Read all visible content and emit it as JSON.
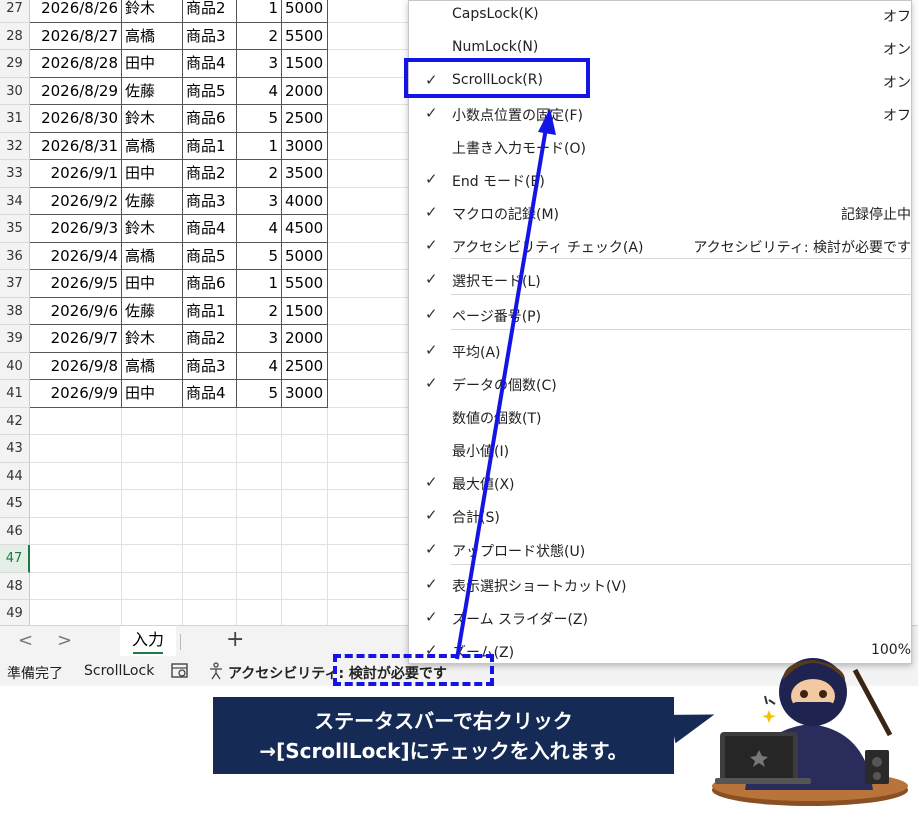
{
  "sheet": {
    "rows": [
      {
        "n": "27",
        "date": "2026/8/26",
        "name": "鈴木",
        "item": "商品2",
        "qty": "1",
        "amount": "5000"
      },
      {
        "n": "28",
        "date": "2026/8/27",
        "name": "高橋",
        "item": "商品3",
        "qty": "2",
        "amount": "5500"
      },
      {
        "n": "29",
        "date": "2026/8/28",
        "name": "田中",
        "item": "商品4",
        "qty": "3",
        "amount": "1500"
      },
      {
        "n": "30",
        "date": "2026/8/29",
        "name": "佐藤",
        "item": "商品5",
        "qty": "4",
        "amount": "2000"
      },
      {
        "n": "31",
        "date": "2026/8/30",
        "name": "鈴木",
        "item": "商品6",
        "qty": "5",
        "amount": "2500"
      },
      {
        "n": "32",
        "date": "2026/8/31",
        "name": "高橋",
        "item": "商品1",
        "qty": "1",
        "amount": "3000"
      },
      {
        "n": "33",
        "date": "2026/9/1",
        "name": "田中",
        "item": "商品2",
        "qty": "2",
        "amount": "3500"
      },
      {
        "n": "34",
        "date": "2026/9/2",
        "name": "佐藤",
        "item": "商品3",
        "qty": "3",
        "amount": "4000"
      },
      {
        "n": "35",
        "date": "2026/9/3",
        "name": "鈴木",
        "item": "商品4",
        "qty": "4",
        "amount": "4500"
      },
      {
        "n": "36",
        "date": "2026/9/4",
        "name": "高橋",
        "item": "商品5",
        "qty": "5",
        "amount": "5000"
      },
      {
        "n": "37",
        "date": "2026/9/5",
        "name": "田中",
        "item": "商品6",
        "qty": "1",
        "amount": "5500"
      },
      {
        "n": "38",
        "date": "2026/9/6",
        "name": "佐藤",
        "item": "商品1",
        "qty": "2",
        "amount": "1500"
      },
      {
        "n": "39",
        "date": "2026/9/7",
        "name": "鈴木",
        "item": "商品2",
        "qty": "3",
        "amount": "2000"
      },
      {
        "n": "40",
        "date": "2026/9/8",
        "name": "高橋",
        "item": "商品3",
        "qty": "4",
        "amount": "2500"
      },
      {
        "n": "41",
        "date": "2026/9/9",
        "name": "田中",
        "item": "商品4",
        "qty": "5",
        "amount": "3000"
      },
      {
        "n": "42"
      },
      {
        "n": "43"
      },
      {
        "n": "44"
      },
      {
        "n": "45"
      },
      {
        "n": "46"
      },
      {
        "n": "47",
        "selected": true
      },
      {
        "n": "48"
      },
      {
        "n": "49"
      }
    ]
  },
  "tabs": {
    "prev": "<",
    "next": ">",
    "active": "入力",
    "add": "+"
  },
  "status": {
    "ready": "準備完了",
    "scrolllock": "ScrollLock",
    "accessibility": "アクセシビリティ: 検討が必要です"
  },
  "menu": {
    "items": [
      {
        "label": "CapsLock(K)",
        "value": "オフ",
        "checked": false
      },
      {
        "label": "NumLock(N)",
        "value": "オン",
        "checked": false
      },
      {
        "label": "ScrollLock(R)",
        "value": "オン",
        "checked": true
      },
      {
        "label": "小数点位置の固定(F)",
        "value": "オフ",
        "checked": true
      },
      {
        "label": "上書き入力モード(O)",
        "value": "",
        "checked": false
      },
      {
        "label": "End モード(E)",
        "value": "",
        "checked": true
      },
      {
        "label": "マクロの記録(M)",
        "value": "記録停止中",
        "checked": true
      },
      {
        "label": "アクセシビリティ チェック(A)",
        "value": "アクセシビリティ: 検討が必要です",
        "checked": true
      },
      {
        "label": "選択モード(L)",
        "value": "",
        "checked": true
      },
      {
        "label": "ページ番号(P)",
        "value": "",
        "checked": true
      },
      {
        "label": "平均(A)",
        "value": "",
        "checked": true
      },
      {
        "label": "データの個数(C)",
        "value": "",
        "checked": true
      },
      {
        "label": "数値の個数(T)",
        "value": "",
        "checked": false
      },
      {
        "label": "最小値(I)",
        "value": "",
        "checked": false
      },
      {
        "label": "最大値(X)",
        "value": "",
        "checked": true
      },
      {
        "label": "合計(S)",
        "value": "",
        "checked": true
      },
      {
        "label": "アップロード状態(U)",
        "value": "",
        "checked": true
      },
      {
        "label": "表示選択ショートカット(V)",
        "value": "",
        "checked": true
      },
      {
        "label": "ズーム スライダー(Z)",
        "value": "",
        "checked": true
      },
      {
        "label": "ズーム(Z)",
        "value": "100%",
        "checked": true
      }
    ]
  },
  "caption": {
    "line1": "ステータスバーで右クリック",
    "line2": "→[ScrollLock]にチェックを入れます。"
  },
  "colors": {
    "highlight": "#1414e6",
    "caption_bg": "#152a55",
    "accent": "#1d7a44"
  }
}
